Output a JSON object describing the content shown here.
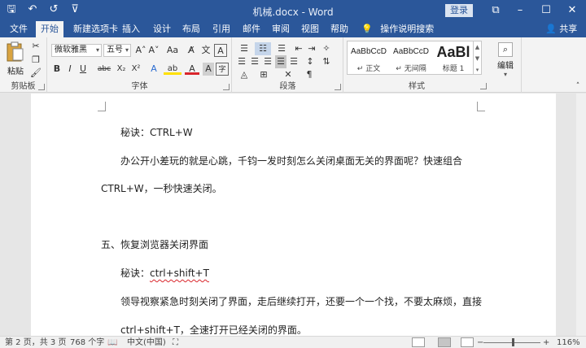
{
  "titlebar": {
    "doc_title": "机械.docx  -  Word",
    "login_label": "登录",
    "qat_icons": [
      "save-icon",
      "undo-icon",
      "redo-icon",
      "customize-icon"
    ],
    "qat_glyphs": [
      "🖫",
      "↶",
      "↺",
      "⊽"
    ],
    "minimize": "–",
    "restore": "⧉",
    "maximize": "☐",
    "close": "✕"
  },
  "tabs": [
    {
      "label": "文件",
      "active": false
    },
    {
      "label": "开始",
      "active": true
    },
    {
      "label": "新建选项卡",
      "active": false
    },
    {
      "label": "插入",
      "active": false
    },
    {
      "label": "设计",
      "active": false
    },
    {
      "label": "布局",
      "active": false
    },
    {
      "label": "引用",
      "active": false
    },
    {
      "label": "邮件",
      "active": false
    },
    {
      "label": "审阅",
      "active": false
    },
    {
      "label": "视图",
      "active": false
    },
    {
      "label": "帮助",
      "active": false
    }
  ],
  "tellme": {
    "icon": "lightbulb-icon",
    "glyph": "💡",
    "label": "操作说明搜索"
  },
  "share": {
    "icon": "person-icon",
    "glyph": "👤",
    "label": "共享"
  },
  "ribbon": {
    "clipboard": {
      "label": "剪贴板",
      "paste_label": "粘贴"
    },
    "font": {
      "label": "字体",
      "font_name": "微软雅黑",
      "font_size": "五号",
      "grow": "A˄",
      "shrink": "A˅",
      "case": "Aa",
      "bold": "B",
      "italic": "I",
      "underline": "U",
      "strike": "abc",
      "sub": "X₂",
      "sup": "X²",
      "effects": "A",
      "highlight": "ab",
      "color": "A",
      "shading": "A"
    },
    "paragraph": {
      "label": "段落"
    },
    "styles": {
      "label": "样式",
      "items": [
        {
          "sample": "AaBbCcD",
          "name": "↵ 正文"
        },
        {
          "sample": "AaBbCcD",
          "name": "↵ 无间隔"
        },
        {
          "sample": "AaBl",
          "name": "标题 1"
        }
      ]
    },
    "editing": {
      "label": "编辑"
    }
  },
  "document": {
    "lines": [
      {
        "text": "秘诀：CTRL+W"
      },
      {
        "text": "办公开小差玩的就是心跳，千钧一发时刻怎么关闭桌面无关的界面呢？快速组合"
      },
      {
        "text": "CTRL+W，一秒快速关闭。"
      },
      {
        "text": "五、恢复浏览器关闭界面"
      },
      {
        "prefix": "秘诀：",
        "marked": "ctrl+shift+T"
      },
      {
        "text": "领导视察紧急时刻关闭了界面，走后继续打开，还要一个一个找，不要太麻烦，直接"
      },
      {
        "marked": "ctrl+shift+T",
        "suffix": "，全速打开已经关闭的界面。"
      }
    ]
  },
  "statusbar": {
    "page": "第 2 页，共 3 页",
    "words": "768 个字",
    "language": "中文(中国)",
    "zoom": "116%",
    "zoom_minus": "−",
    "zoom_plus": "+"
  }
}
